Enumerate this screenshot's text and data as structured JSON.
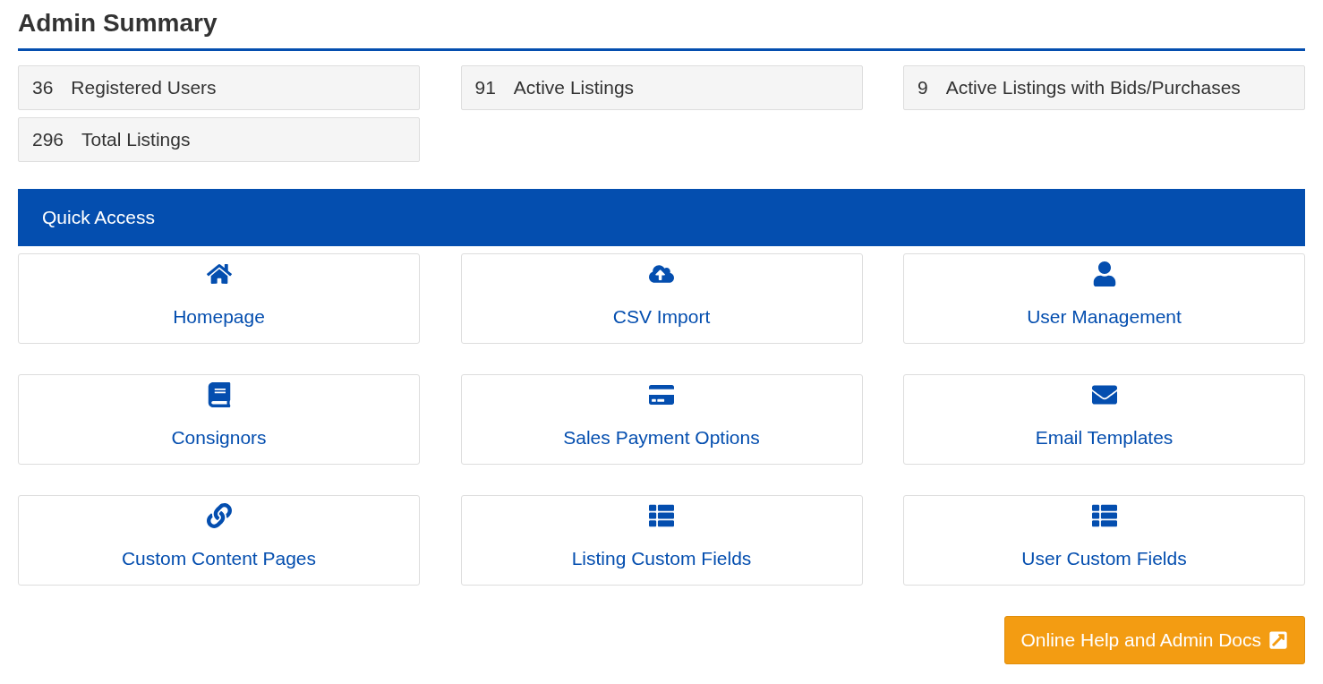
{
  "title": "Admin Summary",
  "stats": [
    {
      "count": "36",
      "label": "Registered Users"
    },
    {
      "count": "91",
      "label": "Active Listings"
    },
    {
      "count": "9",
      "label": "Active Listings with Bids/Purchases"
    },
    {
      "count": "296",
      "label": "Total Listings"
    }
  ],
  "quick_access": {
    "heading": "Quick Access",
    "items": [
      {
        "label": "Homepage"
      },
      {
        "label": "CSV Import"
      },
      {
        "label": "User Management"
      },
      {
        "label": "Consignors"
      },
      {
        "label": "Sales Payment Options"
      },
      {
        "label": "Email Templates"
      },
      {
        "label": "Custom Content Pages"
      },
      {
        "label": "Listing Custom Fields"
      },
      {
        "label": "User Custom Fields"
      }
    ]
  },
  "help_button": {
    "label": "Online Help and Admin Docs"
  }
}
